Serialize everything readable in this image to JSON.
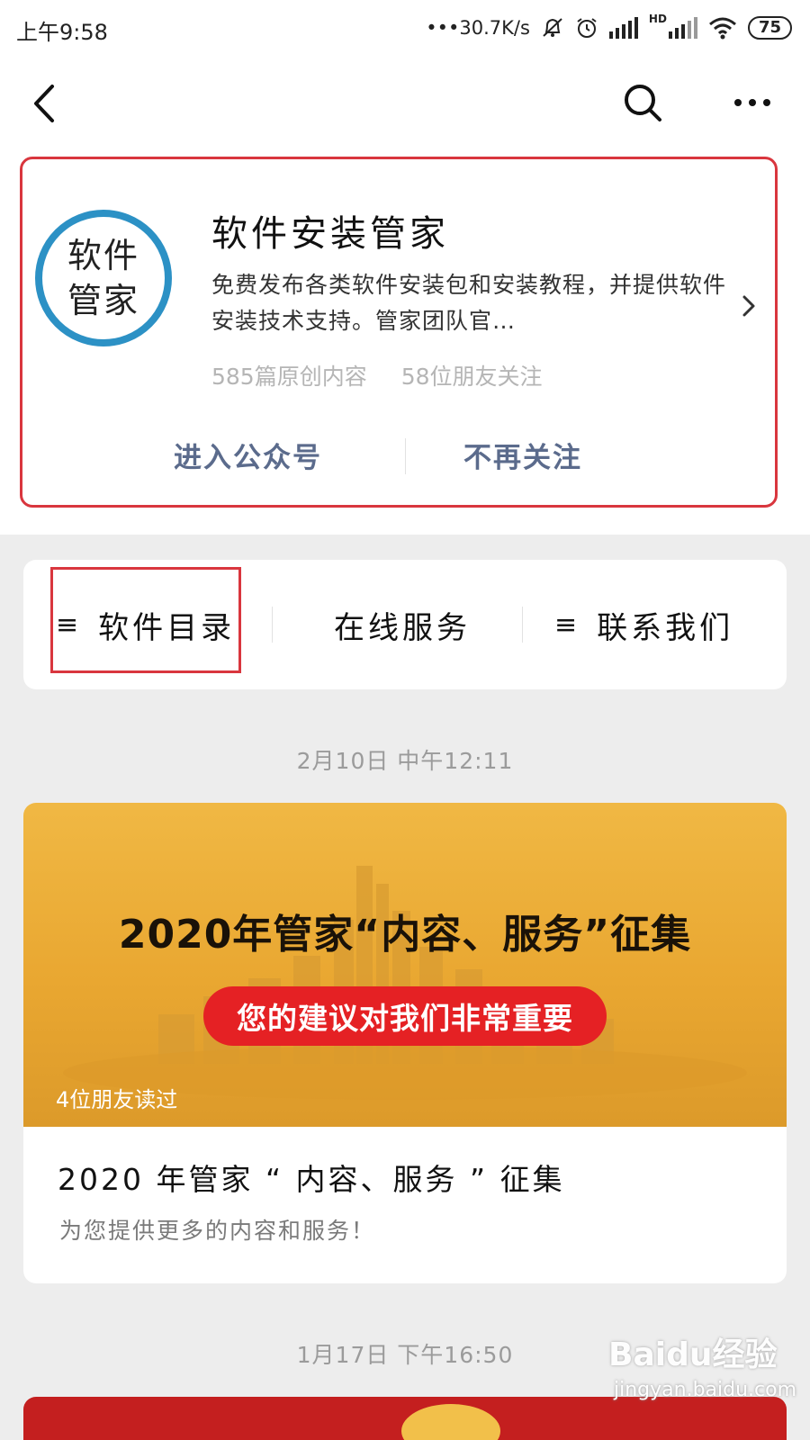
{
  "status_bar": {
    "time": "上午9:58",
    "network_speed": "•••30.7K/s",
    "hd_label": "HD",
    "battery": "75"
  },
  "nav": {
    "back_icon": "back-arrow-icon",
    "search_icon": "search-icon",
    "more_icon": "more-icon"
  },
  "profile": {
    "avatar_text": "软件管家",
    "name": "软件安装管家",
    "description": "免费发布各类软件安装包和安装教程，并提供软件安装技术支持。管家团队官…",
    "stats": [
      "585篇原创内容",
      "58位朋友关注"
    ],
    "actions": {
      "enter": "进入公众号",
      "unfollow": "不再关注"
    },
    "highlight_color": "#d9363e",
    "avatar_ring_color": "#2c91c5"
  },
  "menu": {
    "items": [
      {
        "icon": "≡",
        "label": "软件目录"
      },
      {
        "icon": "",
        "label": "在线服务"
      },
      {
        "icon": "≡",
        "label": "联系我们"
      }
    ]
  },
  "feed": {
    "timestamps": [
      "2月10日 中午12:11",
      "1月17日 下午16:50"
    ],
    "article": {
      "cover_headline": "2020年管家“内容、服务”征集",
      "cover_pill": "您的建议对我们非常重要",
      "friends_read": "4位朋友读过",
      "title": "2020 年管家 “ 内容、服务 ” 征集",
      "summary": "为您提供更多的内容和服务！"
    }
  },
  "watermark": {
    "logo": "Baidu经验",
    "url": "jingyan.baidu.com"
  }
}
